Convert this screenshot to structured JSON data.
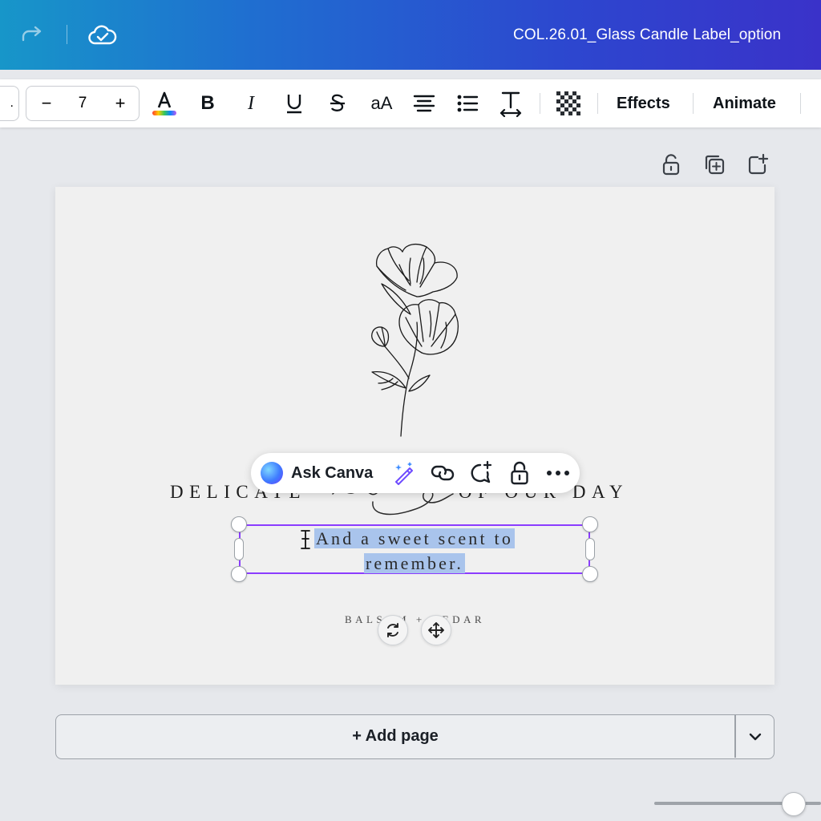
{
  "header": {
    "title": "COL.26.01_Glass Candle Label_option",
    "icons": [
      "redo-icon",
      "cloud-saved-icon"
    ]
  },
  "toolbar": {
    "font_stub": ".",
    "font_size": "7",
    "minus": "−",
    "plus": "+",
    "effects_label": "Effects",
    "animate_label": "Animate",
    "icons": [
      "text-color-icon",
      "bold-icon",
      "italic-icon",
      "underline-icon",
      "strikethrough-icon",
      "letter-case-icon",
      "align-icon",
      "list-icon",
      "spacing-icon",
      "transparency-icon"
    ]
  },
  "page_actions": [
    "lock-icon",
    "duplicate-page-icon",
    "add-page-icon"
  ],
  "design": {
    "line1": "DELICATE",
    "line1_end": "OF OUR DAY",
    "selected_text_line1": "And a sweet scent to",
    "selected_text_line2": "remember.",
    "scent_line": "BALSAM + CEDAR"
  },
  "context_menu": {
    "ask_label": "Ask Canva",
    "icons": [
      "magic-edit-icon",
      "link-icon",
      "comment-icon",
      "lock-icon",
      "more-icon"
    ]
  },
  "add_page": {
    "label": "+ Add page"
  },
  "colors": {
    "selection": "#8b3dff",
    "highlight": "#a9c4ec",
    "header_start": "#1796c9",
    "header_end": "#3a32c9"
  }
}
